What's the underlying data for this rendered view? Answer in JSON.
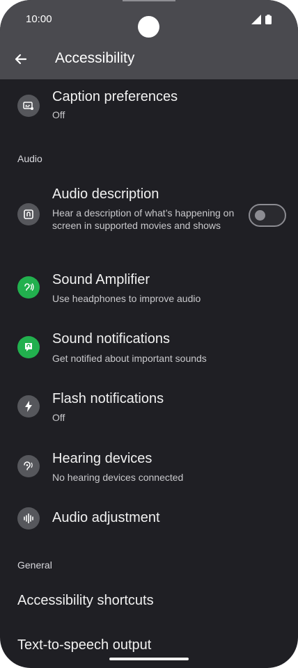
{
  "status": {
    "time": "10:00"
  },
  "header": {
    "title": "Accessibility"
  },
  "items": [
    {
      "title": "Caption preferences",
      "subtitle": "Off"
    },
    {
      "title": "Audio description",
      "subtitle": "Hear a description of what’s happening on screen in supported movies and shows"
    },
    {
      "title": "Sound Amplifier",
      "subtitle": "Use headphones to improve audio"
    },
    {
      "title": "Sound notifications",
      "subtitle": "Get notified about important sounds"
    },
    {
      "title": "Flash notifications",
      "subtitle": "Off"
    },
    {
      "title": "Hearing devices",
      "subtitle": "No hearing devices connected"
    },
    {
      "title": "Audio adjustment"
    }
  ],
  "sections": {
    "audio": "Audio",
    "general": "General"
  },
  "general_items": [
    {
      "title": "Accessibility shortcuts"
    },
    {
      "title": "Text-to-speech output"
    }
  ],
  "toggles": {
    "audio_description": false
  },
  "colors": {
    "background": "#1f1f24",
    "header": "#4a4a4f",
    "icon_bg": "#56575c",
    "icon_green": "#22b04e"
  }
}
